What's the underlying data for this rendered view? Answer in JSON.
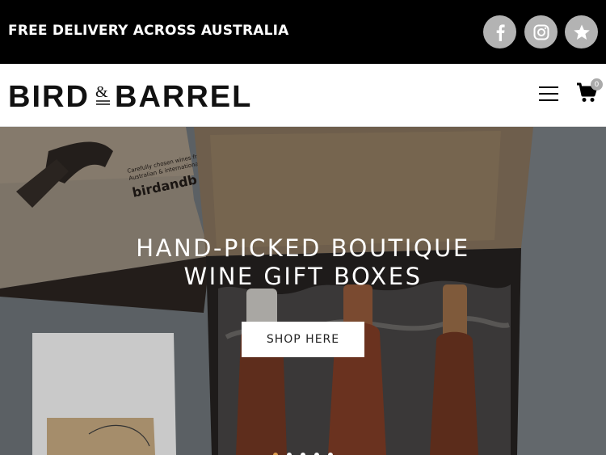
{
  "topbar": {
    "promo_text": "FREE DELIVERY ACROSS AUSTRALIA",
    "social": [
      {
        "icon": "facebook-icon"
      },
      {
        "icon": "instagram-icon"
      },
      {
        "icon": "star-icon"
      }
    ]
  },
  "header": {
    "logo": {
      "part1": "BIRD",
      "amp": "&",
      "part2": "BARREL"
    },
    "cart_count": "0"
  },
  "hero": {
    "title_line1": "HAND-PICKED BOUTIQUE",
    "title_line2": "WINE GIFT BOXES",
    "cta_label": "SHOP HERE",
    "box_brand": "birdandb",
    "box_tagline_1": "Carefully chosen wines from",
    "box_tagline_2": "Australian & international",
    "slides": 5,
    "active_slide": 1
  },
  "colors": {
    "topbar_bg": "#000000",
    "social_bg": "#b3b3b3",
    "accent_dot": "#e0a050"
  }
}
